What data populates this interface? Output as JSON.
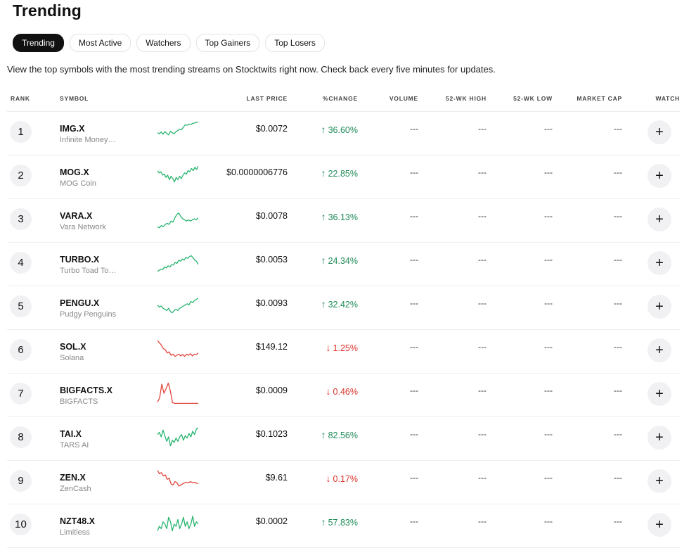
{
  "page": {
    "title": "Trending"
  },
  "tabs": [
    {
      "label": "Trending",
      "active": true
    },
    {
      "label": "Most Active",
      "active": false
    },
    {
      "label": "Watchers",
      "active": false
    },
    {
      "label": "Top Gainers",
      "active": false
    },
    {
      "label": "Top Losers",
      "active": false
    }
  ],
  "description": "View the top symbols with the most trending streams on Stocktwits right now. Check back every five minutes for updates.",
  "colors": {
    "up": "#1e8a57",
    "down": "#d9342b",
    "spark_up": "#27b46f",
    "spark_down": "#e0463c"
  },
  "table": {
    "headers": {
      "rank": "RANK",
      "symbol": "SYMBOL",
      "last_price": "LAST PRICE",
      "change": "%CHANGE",
      "volume": "VOLUME",
      "high52": "52-WK HIGH",
      "low52": "52-WK LOW",
      "market_cap": "MARKET CAP",
      "watch": "WATCH"
    },
    "watch_icon": "plus-icon",
    "rows": [
      {
        "rank": "1",
        "symbol": "IMG.X",
        "name": "Infinite Money Glitch",
        "price": "$0.0072",
        "change": "36.60%",
        "dir": "up",
        "volume": "---",
        "high52": "---",
        "low52": "---",
        "market_cap": "---",
        "watch": "+",
        "spark": [
          0.45,
          0.4,
          0.48,
          0.38,
          0.5,
          0.42,
          0.35,
          0.52,
          0.45,
          0.4,
          0.5,
          0.55,
          0.6,
          0.58,
          0.7,
          0.8,
          0.78,
          0.83,
          0.82,
          0.86,
          0.88,
          0.9,
          0.93
        ]
      },
      {
        "rank": "2",
        "symbol": "MOG.X",
        "name": "MOG Coin",
        "price": "$0.0000006776",
        "change": "22.85%",
        "dir": "up",
        "volume": "---",
        "high52": "---",
        "low52": "---",
        "market_cap": "---",
        "watch": "+",
        "spark": [
          0.7,
          0.6,
          0.65,
          0.5,
          0.55,
          0.4,
          0.5,
          0.3,
          0.45,
          0.35,
          0.2,
          0.4,
          0.3,
          0.45,
          0.35,
          0.5,
          0.6,
          0.55,
          0.7,
          0.65,
          0.8,
          0.7,
          0.85,
          0.75,
          0.9
        ]
      },
      {
        "rank": "3",
        "symbol": "VARA.X",
        "name": "Vara Network",
        "price": "$0.0078",
        "change": "36.13%",
        "dir": "up",
        "volume": "---",
        "high52": "---",
        "low52": "---",
        "market_cap": "---",
        "watch": "+",
        "spark": [
          0.15,
          0.1,
          0.2,
          0.15,
          0.25,
          0.3,
          0.25,
          0.4,
          0.35,
          0.55,
          0.7,
          0.75,
          0.6,
          0.5,
          0.45,
          0.4,
          0.45,
          0.4,
          0.45,
          0.5,
          0.45,
          0.55
        ]
      },
      {
        "rank": "4",
        "symbol": "TURBO.X",
        "name": "Turbo Toad Token",
        "price": "$0.0053",
        "change": "24.34%",
        "dir": "up",
        "volume": "---",
        "high52": "---",
        "low52": "---",
        "market_cap": "---",
        "watch": "+",
        "spark": [
          0.1,
          0.15,
          0.2,
          0.18,
          0.3,
          0.25,
          0.35,
          0.3,
          0.4,
          0.38,
          0.5,
          0.45,
          0.6,
          0.55,
          0.65,
          0.6,
          0.72,
          0.68,
          0.75,
          0.8,
          0.72,
          0.6,
          0.55,
          0.4
        ]
      },
      {
        "rank": "5",
        "symbol": "PENGU.X",
        "name": "Pudgy Penguins",
        "price": "$0.0093",
        "change": "32.42%",
        "dir": "up",
        "volume": "---",
        "high52": "---",
        "low52": "---",
        "market_cap": "---",
        "watch": "+",
        "spark": [
          0.55,
          0.45,
          0.5,
          0.4,
          0.35,
          0.3,
          0.4,
          0.25,
          0.2,
          0.3,
          0.35,
          0.3,
          0.4,
          0.45,
          0.5,
          0.55,
          0.6,
          0.55,
          0.7,
          0.65,
          0.75,
          0.8,
          0.85
        ]
      },
      {
        "rank": "6",
        "symbol": "SOL.X",
        "name": "Solana",
        "price": "$149.12",
        "change": "1.25%",
        "dir": "down",
        "volume": "---",
        "high52": "---",
        "low52": "---",
        "market_cap": "---",
        "watch": "+",
        "spark": [
          0.9,
          0.8,
          0.7,
          0.55,
          0.5,
          0.35,
          0.4,
          0.25,
          0.3,
          0.2,
          0.25,
          0.3,
          0.22,
          0.28,
          0.2,
          0.3,
          0.25,
          0.32,
          0.22,
          0.3,
          0.28,
          0.35
        ]
      },
      {
        "rank": "7",
        "symbol": "BIGFACTS.X",
        "name": "BIGFACTS",
        "price": "$0.0009",
        "change": "0.46%",
        "dir": "down",
        "volume": "---",
        "high52": "---",
        "low52": "---",
        "market_cap": "---",
        "watch": "+",
        "spark": [
          0.1,
          0.3,
          0.9,
          0.5,
          0.7,
          0.95,
          0.6,
          0.08,
          0.05,
          0.05,
          0.05,
          0.05,
          0.05,
          0.05,
          0.05,
          0.05,
          0.05,
          0.05,
          0.05,
          0.05
        ]
      },
      {
        "rank": "8",
        "symbol": "TAI.X",
        "name": "TARS AI",
        "price": "$0.1023",
        "change": "82.56%",
        "dir": "up",
        "volume": "---",
        "high52": "---",
        "low52": "---",
        "market_cap": "---",
        "watch": "+",
        "spark": [
          0.6,
          0.7,
          0.5,
          0.8,
          0.55,
          0.3,
          0.5,
          0.1,
          0.35,
          0.25,
          0.45,
          0.3,
          0.5,
          0.6,
          0.35,
          0.55,
          0.45,
          0.65,
          0.5,
          0.75,
          0.6,
          0.85,
          0.9
        ]
      },
      {
        "rank": "9",
        "symbol": "ZEN.X",
        "name": "ZenCash",
        "price": "$9.61",
        "change": "0.17%",
        "dir": "down",
        "volume": "---",
        "high52": "---",
        "low52": "---",
        "market_cap": "---",
        "watch": "+",
        "spark": [
          0.95,
          0.8,
          0.85,
          0.7,
          0.75,
          0.55,
          0.6,
          0.35,
          0.3,
          0.45,
          0.4,
          0.25,
          0.3,
          0.35,
          0.4,
          0.42,
          0.4,
          0.45,
          0.4,
          0.42,
          0.38,
          0.36
        ]
      },
      {
        "rank": "10",
        "symbol": "NZT48.X",
        "name": "Limitless",
        "price": "$0.0002",
        "change": "57.83%",
        "dir": "up",
        "volume": "---",
        "high52": "---",
        "low52": "---",
        "market_cap": "---",
        "watch": "+",
        "spark": [
          0.2,
          0.4,
          0.3,
          0.6,
          0.5,
          0.3,
          0.8,
          0.6,
          0.2,
          0.5,
          0.4,
          0.7,
          0.3,
          0.5,
          0.8,
          0.4,
          0.6,
          0.3,
          0.5,
          0.85,
          0.4,
          0.6,
          0.5
        ]
      }
    ]
  }
}
